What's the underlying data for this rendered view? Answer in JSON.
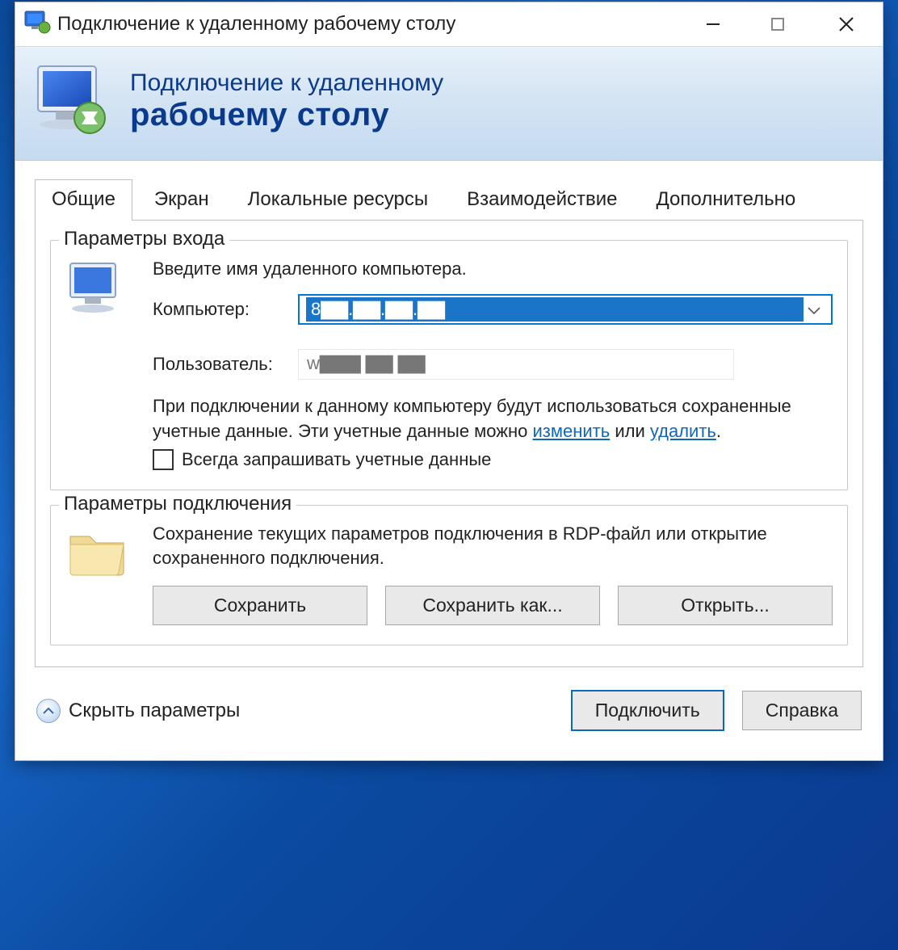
{
  "window": {
    "title": "Подключение к удаленному рабочему столу"
  },
  "banner": {
    "line1": "Подключение к удаленному",
    "line2": "рабочему столу"
  },
  "tabs": [
    "Общие",
    "Экран",
    "Локальные ресурсы",
    "Взаимодействие",
    "Дополнительно"
  ],
  "login_group": {
    "legend": "Параметры входа",
    "instruction": "Введите имя удаленного компьютера.",
    "computer_label": "Компьютер:",
    "computer_value": "8▇▇.▇▇.▇▇.▇▇",
    "user_label": "Пользователь:",
    "user_value": "w▇▇▇ ▇▇ ▇▇",
    "saved_creds_part1": "При подключении к данному компьютеру будут использоваться сохраненные учетные данные.  Эти учетные данные можно ",
    "edit_link": "изменить",
    "or": " или ",
    "delete_link": "удалить",
    "period": ".",
    "always_ask": "Всегда запрашивать учетные данные"
  },
  "conn_group": {
    "legend": "Параметры подключения",
    "desc": "Сохранение текущих параметров подключения в RDP-файл или открытие сохраненного подключения.",
    "save": "Сохранить",
    "save_as": "Сохранить как...",
    "open": "Открыть..."
  },
  "footer": {
    "toggle": "Скрыть параметры",
    "connect": "Подключить",
    "help": "Справка"
  }
}
